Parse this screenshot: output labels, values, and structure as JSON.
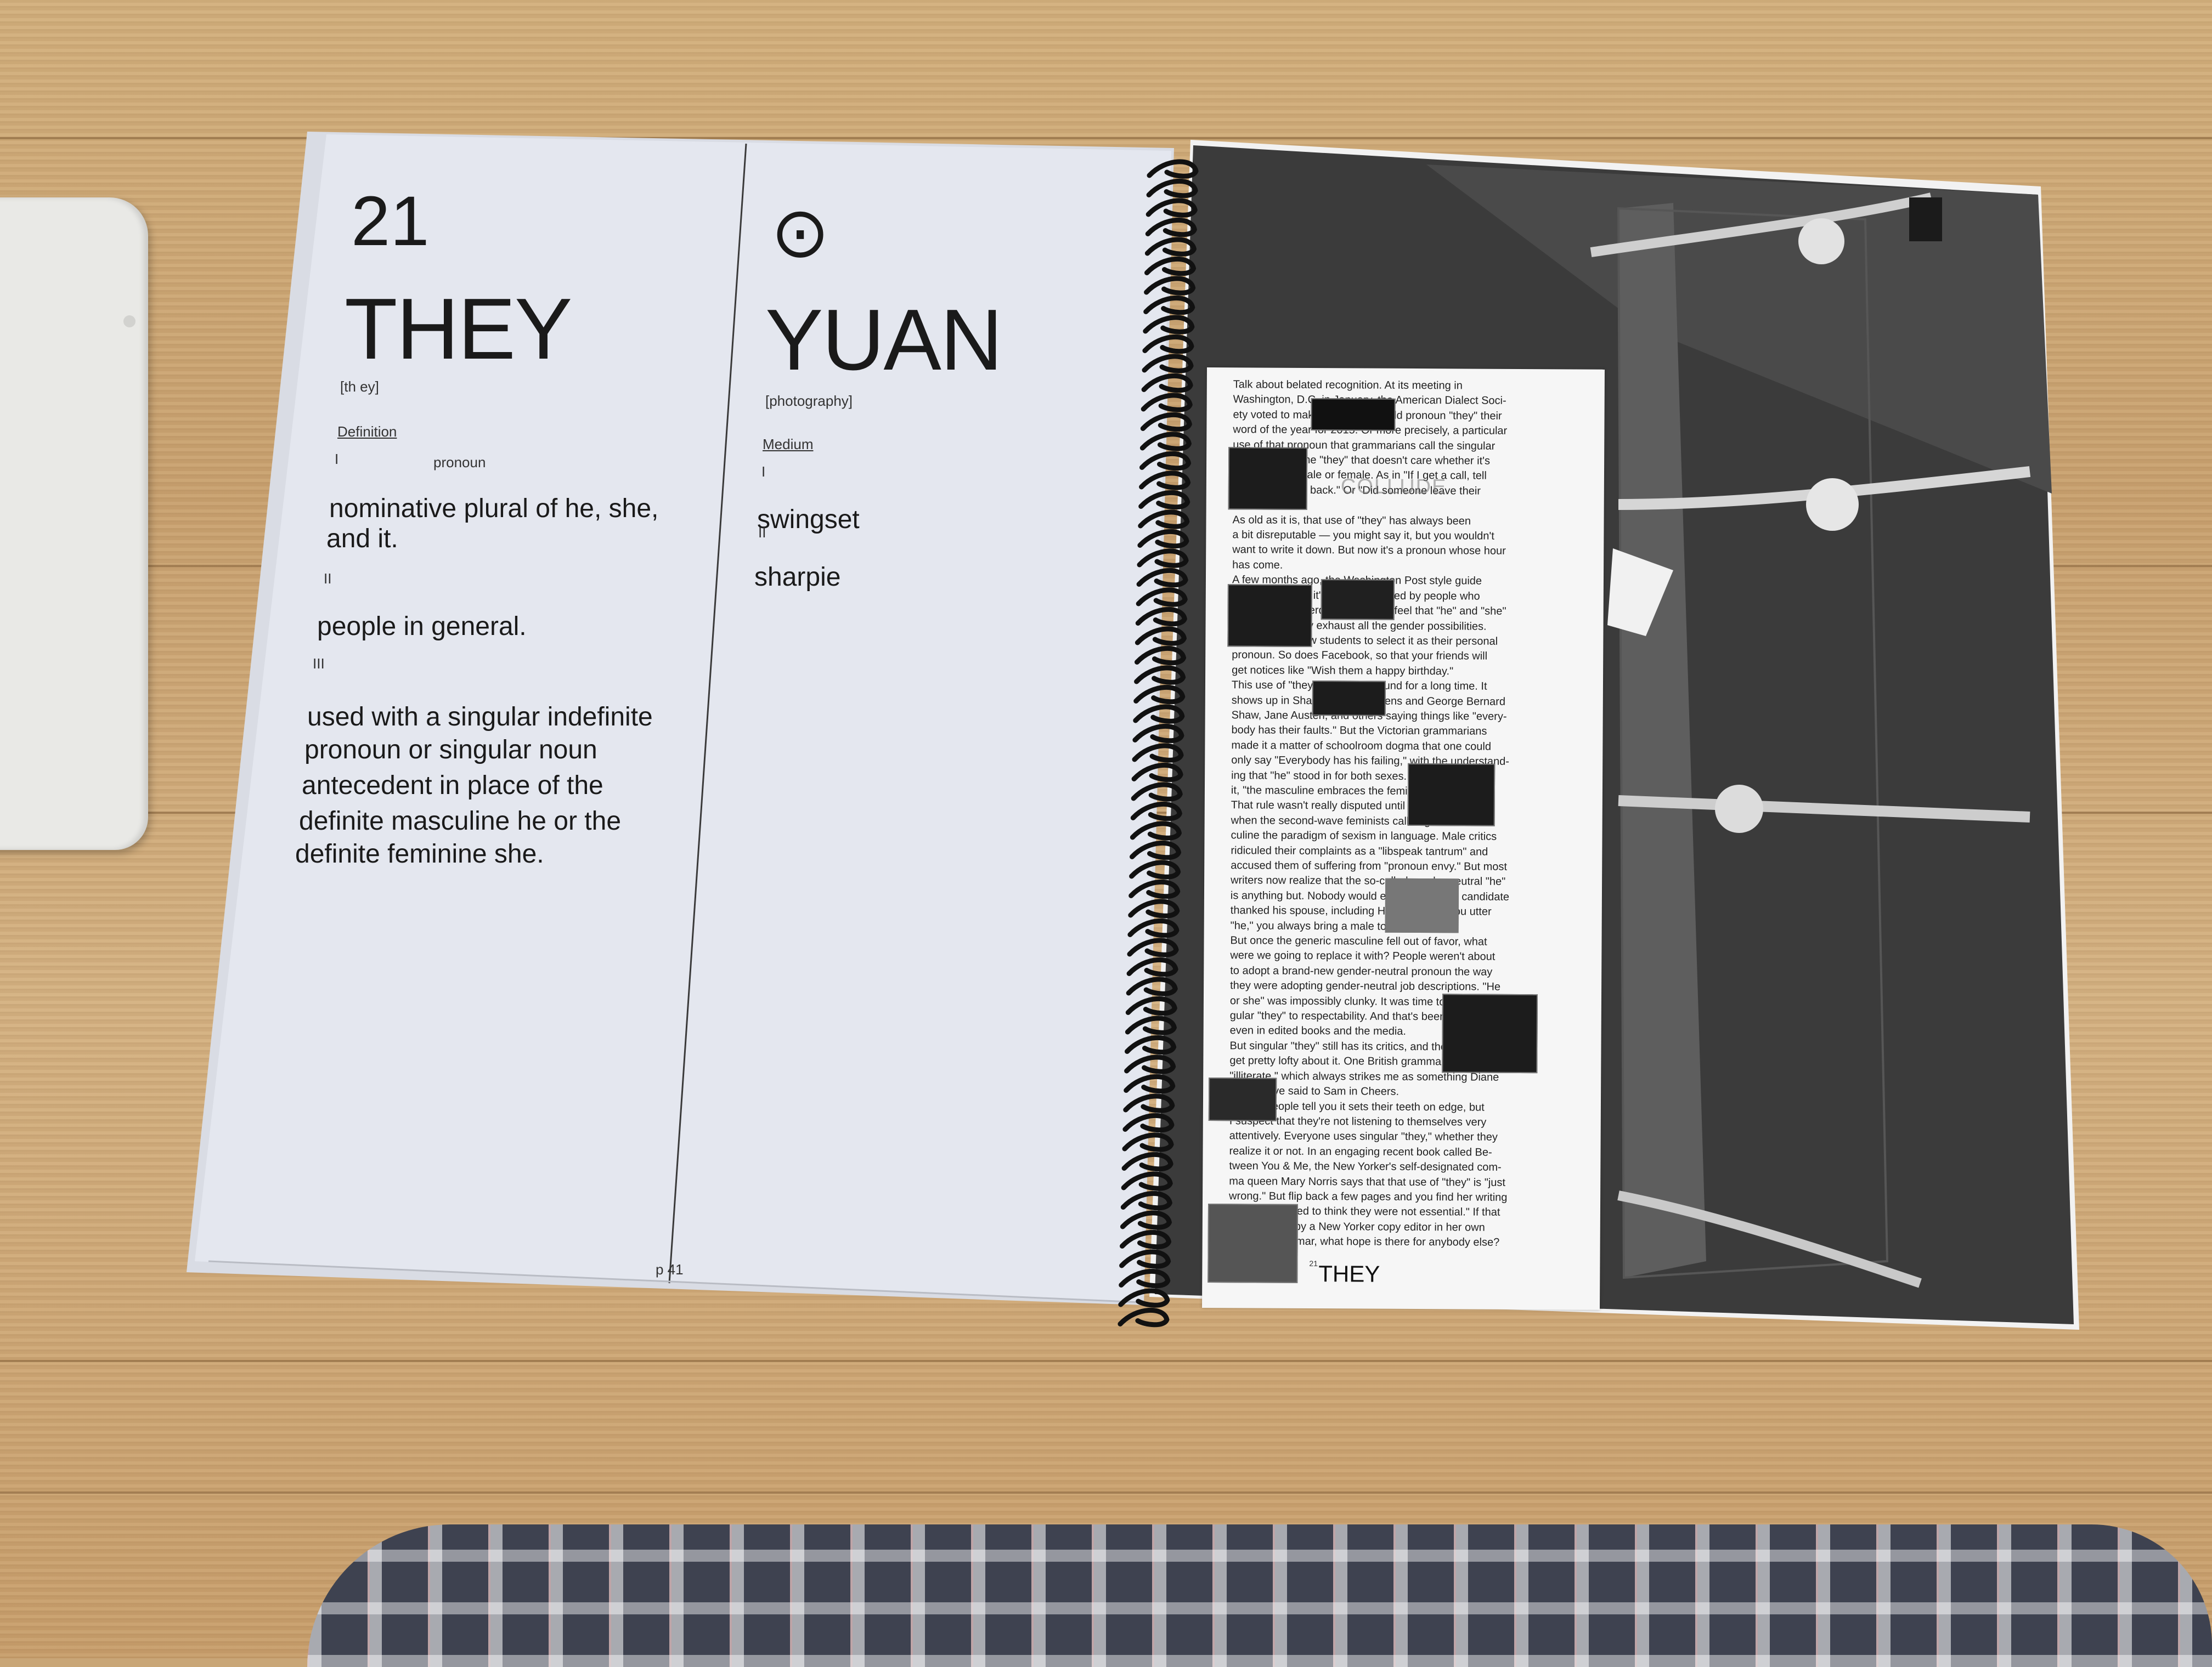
{
  "left_page": {
    "left_column": {
      "number": "21",
      "word": "THEY",
      "pronunciation": "[th ey]",
      "section_label": "Definition",
      "sense_1_marker": "I",
      "part_of_speech": "pronoun",
      "sense_1_lines": [
        "nominative plural of he, she,",
        "and it."
      ],
      "sense_2_marker": "II",
      "sense_2": "people  in general.",
      "sense_3_marker": "III",
      "sense_3_lines": [
        "used with a singular indefinite",
        "pronoun or singular noun",
        "antecedent in place of the",
        "definite masculine he or the",
        "definite feminine she."
      ],
      "page_number": "p 41"
    },
    "right_column": {
      "symbol": "⊙",
      "name": "YUAN",
      "category": "[photography]",
      "section_label": "Medium",
      "item_1_marker": "I",
      "item_1": "swingset",
      "item_2_marker": "II",
      "item_2": "sharpie"
    }
  },
  "right_page": {
    "essay_lines": [
      "Talk about belated recognition. At its meeting in",
      "Washington, D.C. in January, the American Dialect Soci-",
      "ety voted to make the 700-year-old pronoun \"they\" their",
      "word of the year for 2015. Or more precisely, a particular",
      "use of that pronoun that grammarians call the singular",
      "\"they.\" This is the \"they\" that doesn't care whether it's",
      "referring to a male or female. As in \"If I get a call, tell",
      "them to call me back.\" Or \"Did someone leave their",
      "umbrella?\"",
      "As old as it is, that use of \"they\" has always been",
      "a bit disreputable — you might say it, but you wouldn't",
      "want to write it down. But now it's a pronoun whose hour",
      "has come.",
      "A few months ago, the Washington Post style guide",
      "accepted it. And it's been welcomed by people who",
      "identify as genderqueer and who feel that \"he\" and \"she\"",
      "don't necessarily exhaust all the gender possibilities.",
      "Universities allow students to select it as their personal",
      "pronoun. So does Facebook, so that your friends will",
      "get notices like \"Wish them a happy birthday.\"",
      "",
      "This use of \"they\" has been around for a long time. It",
      "shows up in Shakespeare, Dickens and George Bernard",
      "Shaw, Jane Austen, and others saying things like \"every-",
      "body has their faults.\" But the Victorian grammarians",
      "made it a matter of schoolroom dogma that one could",
      "only say \"Everybody has his failing,\" with the understand-",
      "ing that \"he\" stood in for both sexes. As one man had",
      "it, \"the masculine embraces the feminine.\"",
      "That rule wasn't really disputed until the 1970s,",
      "when the second-wave feminists called generic mas-",
      "culine the paradigm of sexism in language. Male critics",
      "ridiculed their complaints as a \"libspeak tantrum\" and",
      "accused them of suffering from \"pronoun envy.\" But most",
      "writers now realize that the so-called gender-neutral \"he\"",
      "is anything but. Nobody would ever say, \"Every candidate",
      "thanked his spouse, including Hillary.\" When you utter",
      "\"he,\" you always bring a male to mind.",
      "But once the generic masculine fell out of favor, what",
      "were we going to replace it with? People weren't about",
      "to adopt a brand-new gender-neutral pronoun the way",
      "they were adopting gender-neutral job descriptions. \"He",
      "or she\" was impossibly clunky. It was time to restore sin-",
      "gular \"they\" to respectability. And that's been happening,",
      "even in edited books and the media.",
      "But singular \"they\" still has its critics, and they can",
      "get pretty lofty about it. One British grammarian calls",
      "\"illiterate,\" which always strikes me as something Diane",
      "would have said to Sam in Cheers.",
      "A lot of people tell you it sets their teeth on edge, but",
      "I suspect that they're not listening to themselves very",
      "attentively. Everyone uses singular \"they,\" whether they",
      "realize it or not. In an engaging recent book called Be-",
      "tween You & Me, the New Yorker's self-designated com-",
      "ma queen Mary Norris says that that use of \"they\" is \"just",
      "wrong.\" But flip back a few pages and you find her writing",
      "\"Nobody wanted to think they were not essential.\" If that",
      "sentence got by a New Yorker copy editor in her own",
      "book on grammar, what hope is there for anybody else?"
    ],
    "ghost_word": "COLLUDE",
    "footer_number": "21",
    "footer_word": "THEY"
  },
  "colors": {
    "paper": "#e4e7ef",
    "ink": "#1a1a1a",
    "wood": "#cba274",
    "spiral": "#111111"
  }
}
